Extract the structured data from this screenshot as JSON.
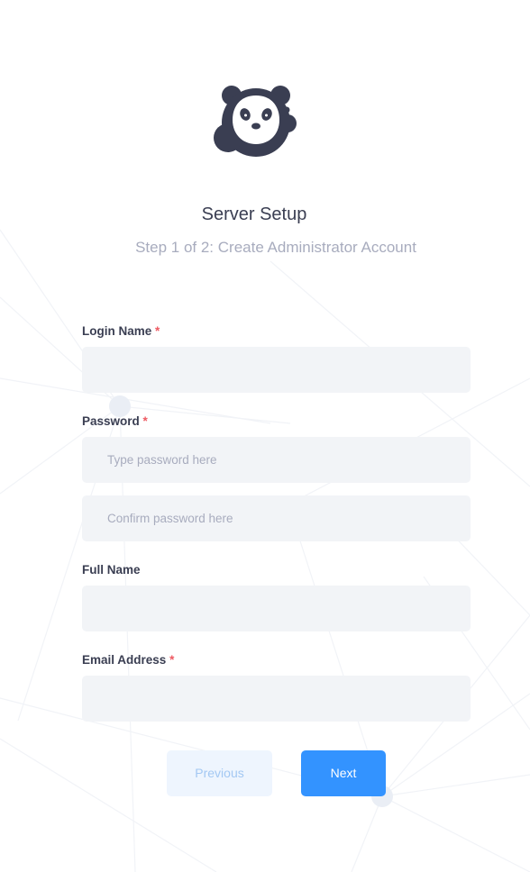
{
  "app": {
    "logo_icon": "panda-logo-icon",
    "title": "Server Setup",
    "subtitle": "Step 1 of 2: Create Administrator Account"
  },
  "form": {
    "login_name": {
      "label": "Login Name",
      "required_marker": "*",
      "value": "",
      "placeholder": ""
    },
    "password": {
      "label": "Password",
      "required_marker": "*",
      "value": "",
      "placeholder": "Type password here"
    },
    "confirm_password": {
      "value": "",
      "placeholder": "Confirm password here"
    },
    "full_name": {
      "label": "Full Name",
      "value": "",
      "placeholder": ""
    },
    "email": {
      "label": "Email Address",
      "required_marker": "*",
      "value": "",
      "placeholder": ""
    }
  },
  "buttons": {
    "previous_label": "Previous",
    "next_label": "Next"
  },
  "colors": {
    "accent": "#3393ff",
    "required": "#ee5a62",
    "field_background": "#f2f4f7",
    "text_primary": "#3a3e52",
    "text_muted": "#a8acbe",
    "disabled_button_background": "#eef5fe",
    "disabled_button_text": "#a3c8f3"
  }
}
